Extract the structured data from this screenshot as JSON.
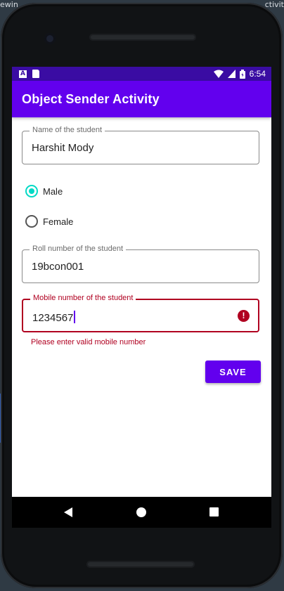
{
  "backdrop": {
    "left_text": "ewin",
    "right_text": "ctivit"
  },
  "status_bar": {
    "time": "6:54"
  },
  "app_bar": {
    "title": "Object Sender Activity"
  },
  "form": {
    "name_field": {
      "label": "Name of the student",
      "value": "Harshit Mody"
    },
    "gender": {
      "options": [
        {
          "label": "Male",
          "checked": true
        },
        {
          "label": "Female",
          "checked": false
        }
      ]
    },
    "roll_field": {
      "label": "Roll number of the student",
      "value": "19bcon001"
    },
    "mobile_field": {
      "label": "Mobile number of the student",
      "value": "1234567",
      "error": "Please enter valid mobile number"
    },
    "save_label": "SAVE"
  },
  "colors": {
    "primary": "#6200ee",
    "status_bar": "#3a0ca3",
    "accent": "#03dac5",
    "error": "#b00020"
  }
}
